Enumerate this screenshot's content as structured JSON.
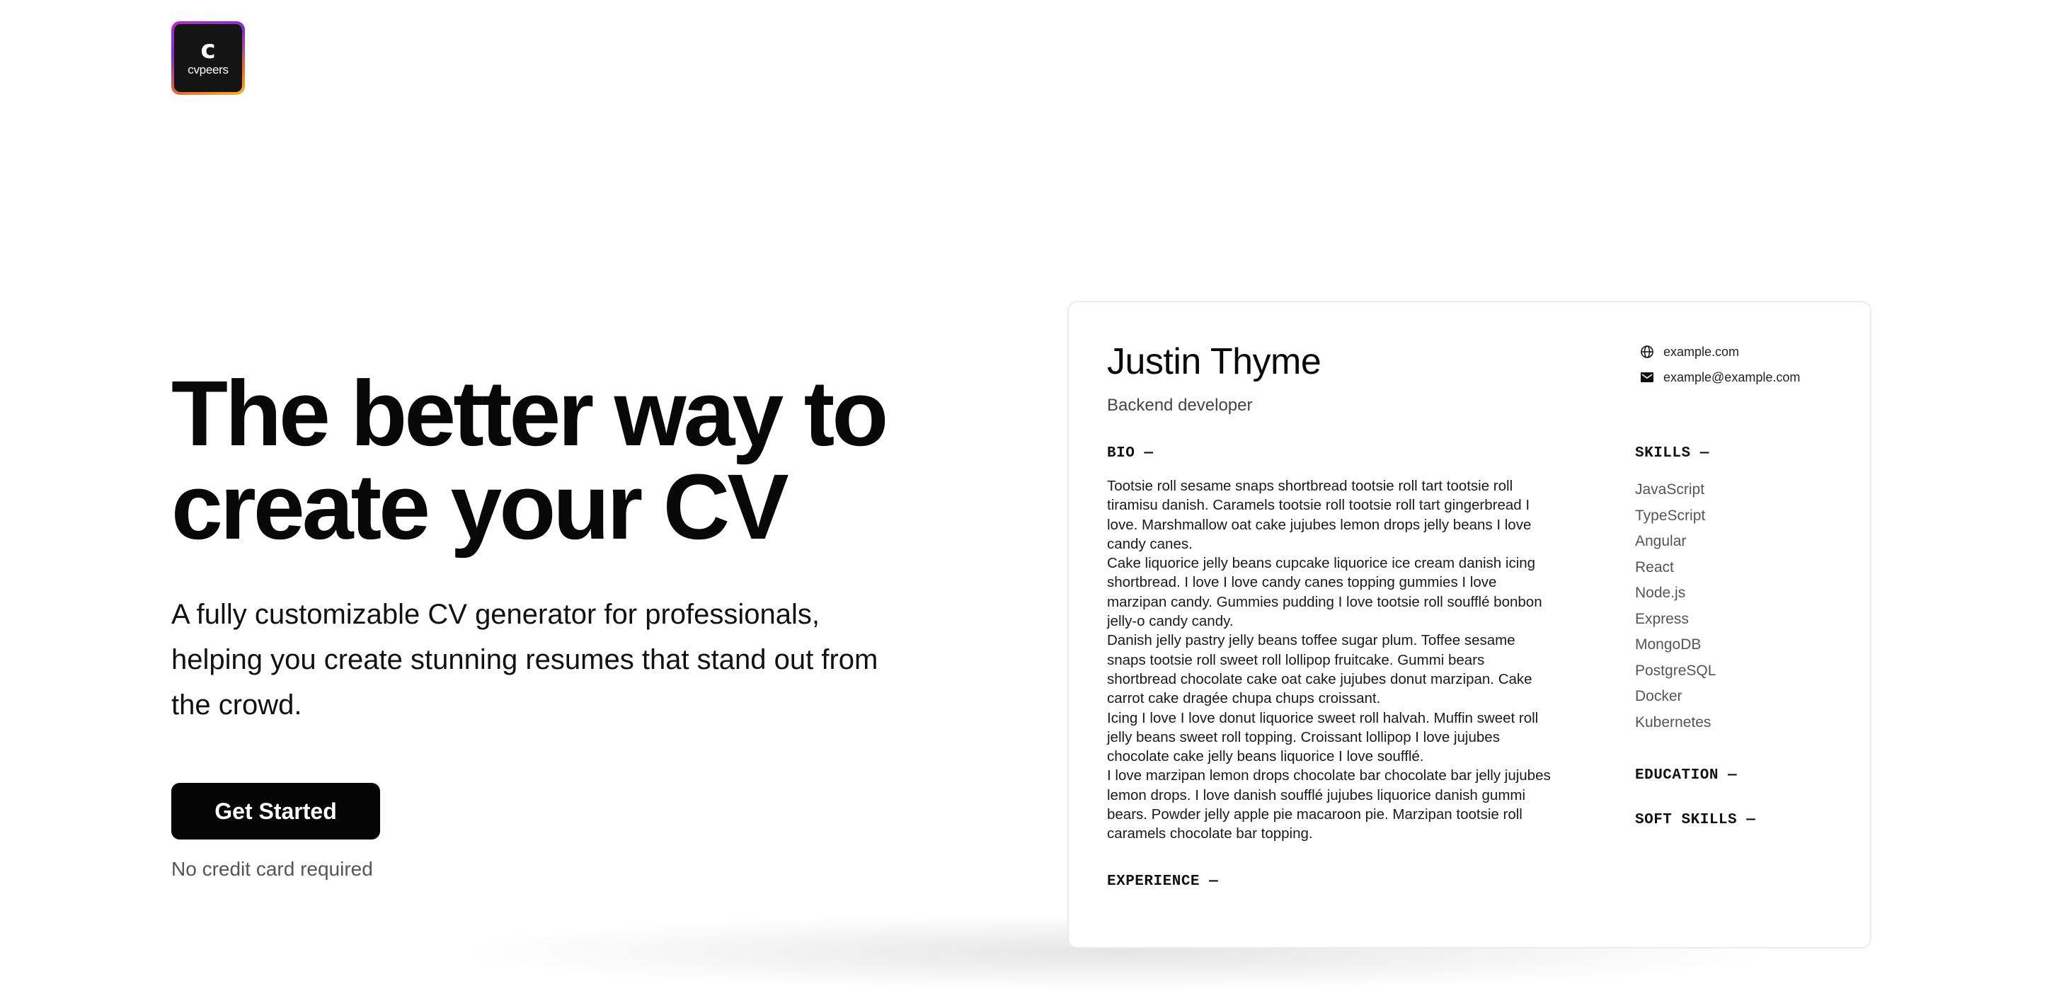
{
  "logo": {
    "letter": "c",
    "wordmark": "cvpeers"
  },
  "hero": {
    "title": "The better way to create your CV",
    "subtitle": "A fully customizable CV generator for professionals, helping you create stunning resumes that stand out from the crowd.",
    "cta_label": "Get Started",
    "cta_note": "No credit card required"
  },
  "cv_preview": {
    "name": "Justin Thyme",
    "role": "Backend developer",
    "contacts": [
      {
        "icon": "globe-icon",
        "text": "example.com"
      },
      {
        "icon": "mail-icon",
        "text": "example@example.com"
      }
    ],
    "bio_heading": "BIO —",
    "bio": "Tootsie roll sesame snaps shortbread tootsie roll tart tootsie roll tiramisu danish. Caramels tootsie roll tootsie roll tart gingerbread I love. Marshmallow oat cake jujubes lemon drops jelly beans I love candy canes.\nCake liquorice jelly beans cupcake liquorice ice cream danish icing shortbread. I love I love candy canes topping gummies I love marzipan candy. Gummies pudding I love tootsie roll soufflé bonbon jelly-o candy candy.\nDanish jelly pastry jelly beans toffee sugar plum. Toffee sesame snaps tootsie roll sweet roll lollipop fruitcake. Gummi bears shortbread chocolate cake oat cake jujubes donut marzipan. Cake carrot cake dragée chupa chups croissant.\nIcing I love I love donut liquorice sweet roll halvah. Muffin sweet roll jelly beans sweet roll topping. Croissant lollipop I love jujubes chocolate cake jelly beans liquorice I love soufflé.\nI love marzipan lemon drops chocolate bar chocolate bar jelly jujubes lemon drops. I love danish soufflé jujubes liquorice danish gummi bears. Powder jelly apple pie macaroon pie. Marzipan tootsie roll caramels chocolate bar topping.",
    "experience_heading": "EXPERIENCE —",
    "skills_heading": "SKILLS —",
    "skills": [
      "JavaScript",
      "TypeScript",
      "Angular",
      "React",
      "Node.js",
      "Express",
      "MongoDB",
      "PostgreSQL",
      "Docker",
      "Kubernetes"
    ],
    "education_heading": "EDUCATION —",
    "soft_skills_heading": "SOFT SKILLS —"
  },
  "colors": {
    "button_bg": "#050505",
    "logo_gradient": [
      "#c02cc4",
      "#7d2fd1",
      "#f26b2d",
      "#ffb21e"
    ]
  }
}
